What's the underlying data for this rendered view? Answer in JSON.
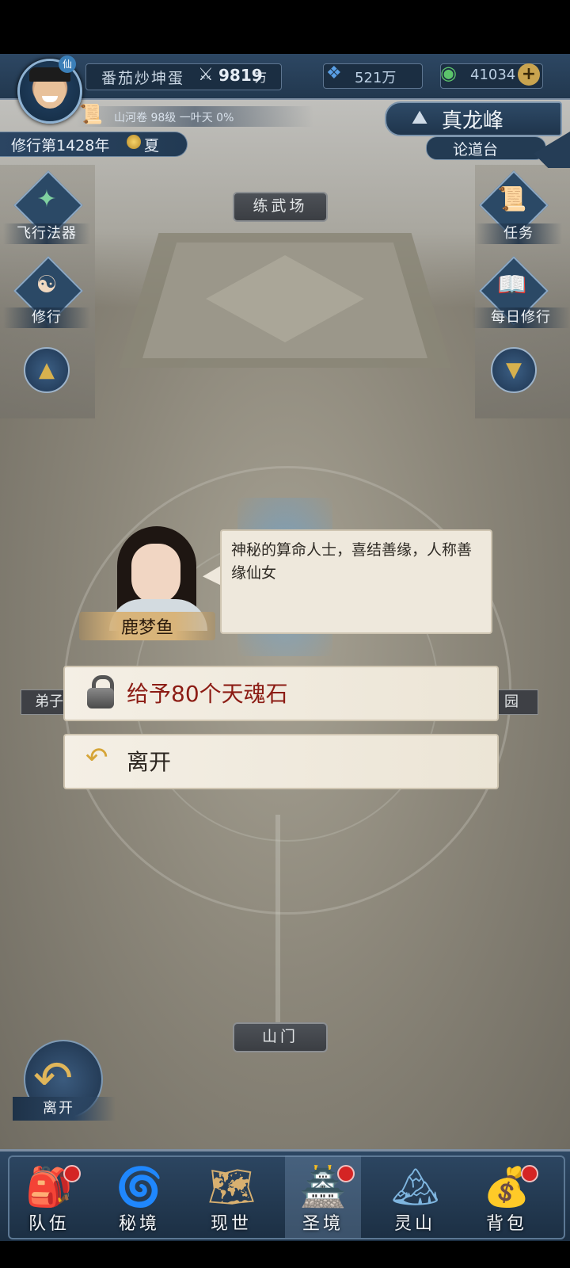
{
  "header": {
    "player_name": "番茄炒坤蛋",
    "power_value": "9819",
    "power_unit": "万",
    "spirit_stones": "521万",
    "jade": "41034",
    "jade_add": "+",
    "xian_badge": "仙",
    "realm_info": "山河卷 98级 一叶天 0%",
    "cultivation_year": "修行第1428年",
    "season": "夏",
    "location_peak": "真龙峰",
    "location_sub": "论道台"
  },
  "side_menu": {
    "left": [
      {
        "label": "飞行法器",
        "icon": "flying-artifact-icon"
      },
      {
        "label": "修行",
        "icon": "cultivate-icon"
      }
    ],
    "right": [
      {
        "label": "任务",
        "icon": "quest-icon"
      },
      {
        "label": "每日修行",
        "icon": "daily-cultivation-icon"
      }
    ]
  },
  "map": {
    "top_plaque": "练武场",
    "bottom_plaque": "山门",
    "left_partial": "弟子",
    "right_partial": "园"
  },
  "dialog": {
    "npc_name": "鹿梦鱼",
    "text": "神秘的算命人士，喜结善缘，人称善缘仙女",
    "options": [
      {
        "label": "给予80个天魂石",
        "icon": "lock-icon",
        "locked": true
      },
      {
        "label": "离开",
        "icon": "return-arrow-icon",
        "locked": false
      }
    ]
  },
  "leave_button": {
    "label": "离开"
  },
  "bottom_nav": [
    {
      "label": "队伍",
      "icon": "team-icon",
      "badge": true,
      "active": false
    },
    {
      "label": "秘境",
      "icon": "secret-realm-icon",
      "badge": false,
      "active": false
    },
    {
      "label": "现世",
      "icon": "world-map-icon",
      "badge": false,
      "active": false
    },
    {
      "label": "圣境",
      "icon": "holy-realm-icon",
      "badge": true,
      "active": true
    },
    {
      "label": "灵山",
      "icon": "spirit-mountain-icon",
      "badge": false,
      "active": false
    },
    {
      "label": "背包",
      "icon": "backpack-icon",
      "badge": true,
      "active": false
    }
  ]
}
